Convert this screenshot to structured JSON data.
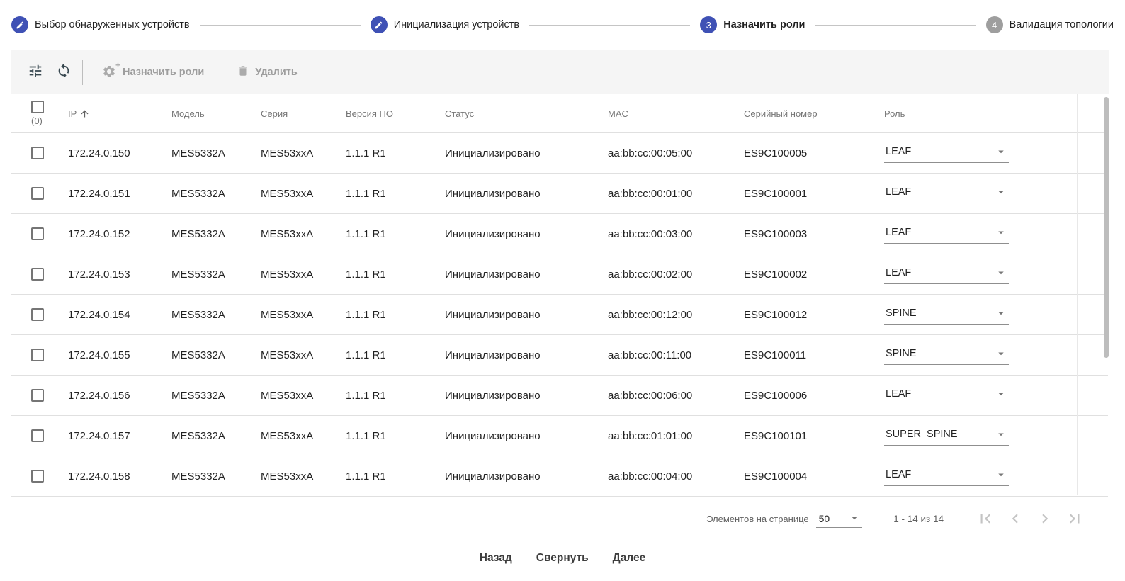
{
  "stepper": {
    "steps": [
      {
        "label": "Выбор обнаруженных устройств",
        "state": "completed",
        "icon": "edit-icon"
      },
      {
        "label": "Инициализация устройств",
        "state": "completed",
        "icon": "edit-icon"
      },
      {
        "label": "Назначить роли",
        "state": "active",
        "number": "3"
      },
      {
        "label": "Валидация топологии",
        "state": "pending",
        "number": "4"
      }
    ]
  },
  "toolbar": {
    "filter_icon": "tune-icon",
    "refresh_icon": "refresh-icon",
    "assign_roles_label": "Назначить роли",
    "delete_label": "Удалить"
  },
  "table": {
    "selected_count": "(0)",
    "sort": {
      "column": "IP",
      "direction": "ascending"
    },
    "columns": [
      "IP",
      "Модель",
      "Серия",
      "Версия ПО",
      "Статус",
      "MAC",
      "Серийный номер",
      "Роль"
    ],
    "rows": [
      {
        "ip": "172.24.0.150",
        "model": "MES5332A",
        "series": "MES53xxA",
        "version": "1.1.1 R1",
        "status": "Инициализировано",
        "mac": "aa:bb:cc:00:05:00",
        "serial": "ES9C100005",
        "role": "LEAF"
      },
      {
        "ip": "172.24.0.151",
        "model": "MES5332A",
        "series": "MES53xxA",
        "version": "1.1.1 R1",
        "status": "Инициализировано",
        "mac": "aa:bb:cc:00:01:00",
        "serial": "ES9C100001",
        "role": "LEAF"
      },
      {
        "ip": "172.24.0.152",
        "model": "MES5332A",
        "series": "MES53xxA",
        "version": "1.1.1 R1",
        "status": "Инициализировано",
        "mac": "aa:bb:cc:00:03:00",
        "serial": "ES9C100003",
        "role": "LEAF"
      },
      {
        "ip": "172.24.0.153",
        "model": "MES5332A",
        "series": "MES53xxA",
        "version": "1.1.1 R1",
        "status": "Инициализировано",
        "mac": "aa:bb:cc:00:02:00",
        "serial": "ES9C100002",
        "role": "LEAF"
      },
      {
        "ip": "172.24.0.154",
        "model": "MES5332A",
        "series": "MES53xxA",
        "version": "1.1.1 R1",
        "status": "Инициализировано",
        "mac": "aa:bb:cc:00:12:00",
        "serial": "ES9C100012",
        "role": "SPINE"
      },
      {
        "ip": "172.24.0.155",
        "model": "MES5332A",
        "series": "MES53xxA",
        "version": "1.1.1 R1",
        "status": "Инициализировано",
        "mac": "aa:bb:cc:00:11:00",
        "serial": "ES9C100011",
        "role": "SPINE"
      },
      {
        "ip": "172.24.0.156",
        "model": "MES5332A",
        "series": "MES53xxA",
        "version": "1.1.1 R1",
        "status": "Инициализировано",
        "mac": "aa:bb:cc:00:06:00",
        "serial": "ES9C100006",
        "role": "LEAF"
      },
      {
        "ip": "172.24.0.157",
        "model": "MES5332A",
        "series": "MES53xxA",
        "version": "1.1.1 R1",
        "status": "Инициализировано",
        "mac": "aa:bb:cc:01:01:00",
        "serial": "ES9C100101",
        "role": "SUPER_SPINE"
      },
      {
        "ip": "172.24.0.158",
        "model": "MES5332A",
        "series": "MES53xxA",
        "version": "1.1.1 R1",
        "status": "Инициализировано",
        "mac": "aa:bb:cc:00:04:00",
        "serial": "ES9C100004",
        "role": "LEAF"
      }
    ]
  },
  "pagination": {
    "items_per_page_label": "Элементов на странице",
    "items_per_page_value": "50",
    "range_label": "1 - 14 из 14"
  },
  "footer": {
    "back_label": "Назад",
    "collapse_label": "Свернуть",
    "next_label": "Далее"
  },
  "colors": {
    "accent": "#3F51B5",
    "pending_step": "#9E9E9E",
    "toolbar_bg": "#F5F5F5",
    "divider": "#E0E0E0",
    "header_text": "#757575",
    "disabled_text": "#9E9E9E",
    "scrollbar": "#BDBDBD"
  }
}
